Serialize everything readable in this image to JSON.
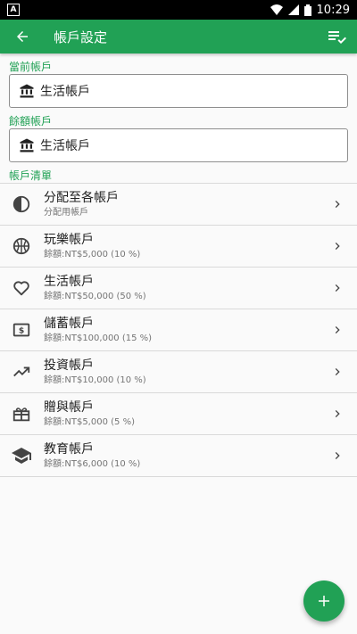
{
  "status_bar": {
    "notification": "A",
    "time": "10:29"
  },
  "app_bar": {
    "title": "帳戶設定"
  },
  "current_account": {
    "label": "當前帳戶",
    "value": "生活帳戶"
  },
  "balance_account": {
    "label": "餘額帳戶",
    "value": "生活帳戶"
  },
  "account_list": {
    "label": "帳戶清單",
    "items": [
      {
        "name": "分配至各帳戶",
        "detail": "分配用帳戶",
        "icon": "pie-half-icon"
      },
      {
        "name": "玩樂帳戶",
        "detail": "餘額:NT$5,000 (10 %)",
        "icon": "basketball-icon"
      },
      {
        "name": "生活帳戶",
        "detail": "餘額:NT$50,000 (50 %)",
        "icon": "heart-icon"
      },
      {
        "name": "儲蓄帳戶",
        "detail": "餘額:NT$100,000 (15 %)",
        "icon": "money-icon"
      },
      {
        "name": "投資帳戶",
        "detail": "餘額:NT$10,000 (10 %)",
        "icon": "trending-up-icon"
      },
      {
        "name": "贈與帳戶",
        "detail": "餘額:NT$5,000 (5 %)",
        "icon": "gift-icon"
      },
      {
        "name": "教育帳戶",
        "detail": "餘額:NT$6,000 (10 %)",
        "icon": "school-icon"
      }
    ]
  },
  "colors": {
    "primary": "#21a155",
    "text": "#212121",
    "secondary_text": "#757575",
    "divider": "#d9d9d9"
  }
}
